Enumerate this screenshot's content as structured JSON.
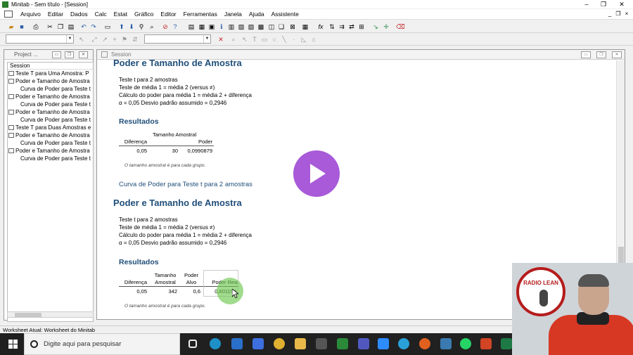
{
  "window": {
    "title": "Minitab - Sem título - [Session]",
    "controls": {
      "minimize": "–",
      "restore": "❐",
      "close": "✕"
    }
  },
  "menu": {
    "items": [
      "Arquivo",
      "Editar",
      "Dados",
      "Calc",
      "Estat",
      "Gráfico",
      "Editor",
      "Ferramentas",
      "Janela",
      "Ajuda",
      "Assistente"
    ],
    "mdi_controls": [
      "_",
      "❐",
      "×"
    ]
  },
  "project_manager": {
    "title": "Project ...",
    "tree_header": "Session",
    "tree_items": [
      "Teste T para Uma Amostra: P",
      "Poder e Tamanho de Amostra",
      "Curva de Poder para Teste t",
      "Poder e Tamanho de Amostra",
      "Curva de Poder para Teste t",
      "Poder e Tamanho de Amostra",
      "Curva de Poder para Teste t",
      "Teste T para Duas Amostras e",
      "Poder e Tamanho de Amostra",
      "Curva de Poder para Teste t",
      "Poder e Tamanho de Amostra",
      "Curva de Poder para Teste t"
    ]
  },
  "session": {
    "title": "Session",
    "block1": {
      "heading": "Poder e Tamanho de Amostra",
      "lines": [
        "Teste t para 2 amostras",
        "Teste de média 1 = média 2 (versus ≠)",
        "Cálculo do poder para média 1 = média 2 + diferença",
        "α = 0,05  Desvio padrão assumido = 0,2946"
      ],
      "results_heading": "Resultados",
      "table": {
        "headers": [
          "Diferença",
          "Tamanho Amostral",
          "Poder"
        ],
        "rows": [
          [
            "0,05",
            "30",
            "0,0990879"
          ]
        ]
      },
      "note": "O tamanho amostral é para cada grupo."
    },
    "curve_link": "Curva de Poder para Teste t para 2 amostras",
    "block2": {
      "heading": "Poder e Tamanho de Amostra",
      "lines": [
        "Teste t para 2 amostras",
        "Teste de média 1 = média 2 (versus ≠)",
        "Cálculo do poder para média 1 = média 2 + diferença",
        "α = 0,05  Desvio padrão assumido = 0,2946"
      ],
      "results_heading": "Resultados",
      "table": {
        "headers": [
          "Diferença",
          "Tamanho Amostral",
          "Poder Alvo",
          "Poder Real"
        ],
        "rows": [
          [
            "0,05",
            "342",
            "0,6",
            "0,601150"
          ]
        ]
      },
      "note": "O tamanho amostral é para cada grupo."
    }
  },
  "status_bar": "Worksheet Atual: Worksheet do Minitab",
  "taskbar": {
    "search_placeholder": "Digite aqui para pesquisar"
  },
  "webcam": {
    "logo_text": "RADIO LEAN"
  },
  "colors": {
    "accent": "#1f4e79",
    "play": "#a85ad8",
    "highlight": "#6ec850",
    "brand_red": "#b51c1c"
  }
}
